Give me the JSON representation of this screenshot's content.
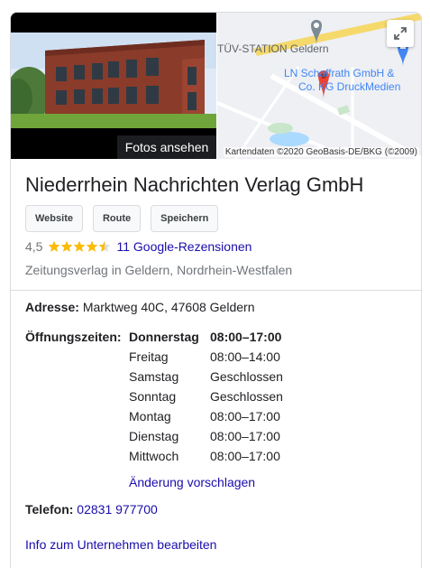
{
  "media": {
    "photos_button": "Fotos ansehen",
    "map_labels": {
      "station": "TÜV-STATION Geldern",
      "business_line1": "LN Schaffrath GmbH &",
      "business_line2": "Co. KG DruckMedien",
      "attribution": "Kartendaten ©2020 GeoBasis-DE/BKG (©2009)"
    }
  },
  "business": {
    "name": "Niederrhein Nachrichten Verlag GmbH",
    "buttons": [
      "Website",
      "Route",
      "Speichern"
    ],
    "rating": "4,5",
    "stars_value": 4.5,
    "reviews_link": "11 Google-Rezensionen",
    "category": "Zeitungsverlag in Geldern, Nordrhein-Westfalen"
  },
  "details": {
    "address_label": "Adresse:",
    "address_value": "Marktweg 40C, 47608 Geldern",
    "hours_label": "Öffnungszeiten:",
    "hours": [
      {
        "day": "Donnerstag",
        "time": "08:00–17:00",
        "current": true
      },
      {
        "day": "Freitag",
        "time": "08:00–14:00"
      },
      {
        "day": "Samstag",
        "time": "Geschlossen"
      },
      {
        "day": "Sonntag",
        "time": "Geschlossen"
      },
      {
        "day": "Montag",
        "time": "08:00–17:00"
      },
      {
        "day": "Dienstag",
        "time": "08:00–17:00"
      },
      {
        "day": "Mittwoch",
        "time": "08:00–17:00"
      }
    ],
    "suggest_edit": "Änderung vorschlagen",
    "phone_label": "Telefon:",
    "phone_value": "02831 977700",
    "edit_business": "Info zum Unternehmen bearbeiten"
  },
  "colors": {
    "link": "#1a0dab",
    "star": "#fbbc04",
    "map_pin": "#ea4335"
  }
}
